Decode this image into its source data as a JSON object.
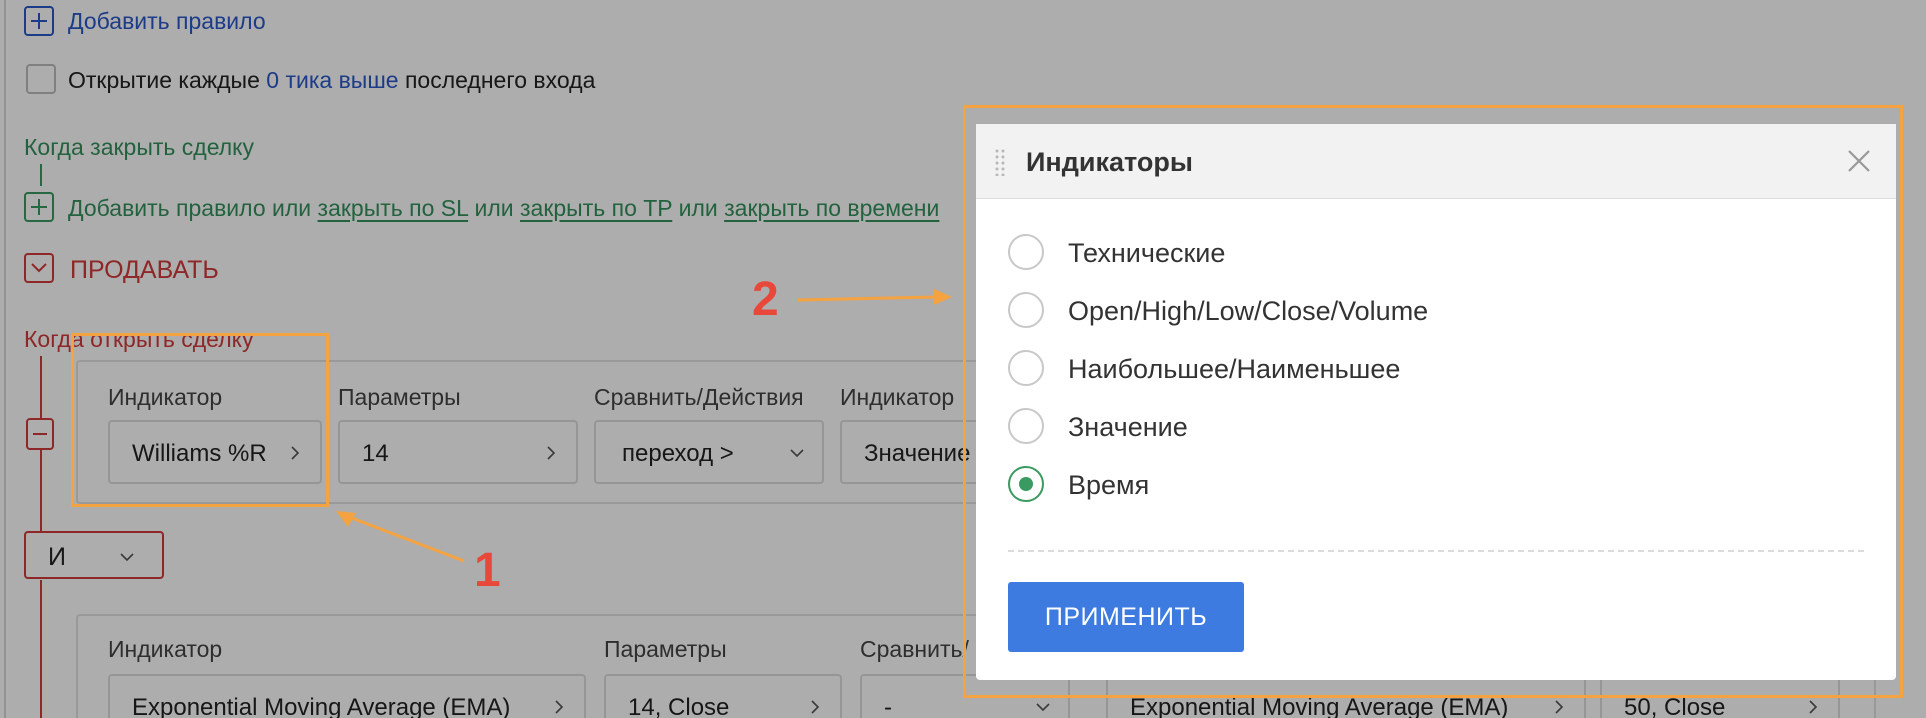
{
  "rules": {
    "add_rule_label": "Добавить правило",
    "open_each_prefix": "Открытие каждые",
    "open_each_value": "0 тика выше",
    "open_each_suffix": "последнего входа"
  },
  "close_section": {
    "title": "Когда закрыть сделку",
    "add_rule": "Добавить правило",
    "or1": "или",
    "close_sl": "закрыть по SL",
    "or2": "или",
    "close_tp": "закрыть по TP",
    "or3": "или",
    "close_time": "закрыть по времени"
  },
  "sell_section": {
    "title": "ПРОДАВАТЬ",
    "open_title": "Когда открыть сделку",
    "logic_operator": "И",
    "condition1": {
      "indicator_label": "Индикатор",
      "indicator_value": "Williams %R",
      "params_label": "Параметры",
      "params_value": "14",
      "compare_label": "Сравнить/Действия",
      "compare_value": "переход >",
      "indicator2_label": "Индикатор",
      "indicator2_value": "Значение"
    },
    "condition2": {
      "indicator_label": "Индикатор",
      "indicator_value": "Exponential Moving Average (EMA)",
      "params_label": "Параметры",
      "params_value": "14, Close",
      "compare_label": "Сравнить/",
      "compare_value": "-",
      "indicator2_value": "Exponential Moving Average (EMA)",
      "params2_value": "50, Close"
    }
  },
  "annotations": {
    "marker1": "1",
    "marker2": "2",
    "accent_color": "#f4a340",
    "number_color": "#e8483a"
  },
  "modal": {
    "title": "Индикаторы",
    "options": [
      {
        "label": "Технические",
        "checked": false
      },
      {
        "label": "Open/High/Low/Close/Volume",
        "checked": false
      },
      {
        "label": "Наибольшее/Наименьшее",
        "checked": false
      },
      {
        "label": "Значение",
        "checked": false
      },
      {
        "label": "Время",
        "checked": true
      }
    ],
    "apply_label": "ПРИМЕНИТЬ",
    "apply_color": "#3d7be0",
    "selected_color": "#3a9a62"
  }
}
